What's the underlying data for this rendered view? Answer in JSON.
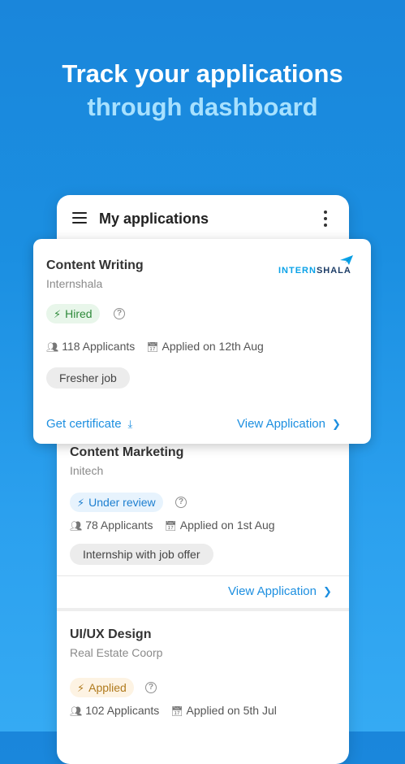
{
  "headline": {
    "line1": "Track your applications",
    "line2": "through dashboard"
  },
  "appbar": {
    "title": "My applications"
  },
  "highlighted_card": {
    "title": "Content Writing",
    "company": "Internshala",
    "logo": {
      "part1": "INTERN",
      "part2": "SHALA"
    },
    "status": {
      "label": "Hired",
      "color": "#e8f6ea",
      "text_color": "#2e8a3a"
    },
    "applicants": "118 Applicants",
    "applied_on": "Applied on 12th Aug",
    "tag": "Fresher job",
    "get_certificate": "Get certificate",
    "view_application": "View Application"
  },
  "cards": [
    {
      "title": "Content Marketing",
      "company": "Initech",
      "status": {
        "label": "Under review",
        "color": "#e7f3fd",
        "text_color": "#1d7fd0"
      },
      "applicants": "78 Applicants",
      "applied_on": "Applied on 1st Aug",
      "tag": "Internship with job offer",
      "view_application": "View Application"
    },
    {
      "title": "UI/UX Design",
      "company": "Real Estate Coorp",
      "status": {
        "label": "Applied",
        "color": "#fdf3e3",
        "text_color": "#b07a1c"
      },
      "applicants": "102 Applicants",
      "applied_on": "Applied on 5th Jul"
    }
  ],
  "icons": {
    "menu": "hamburger-menu-icon",
    "more": "vertical-dots-icon",
    "status": "lightning-bolt-icon",
    "help": "question-circle-icon",
    "applicants": "people-icon",
    "applied_on": "calendar-icon",
    "download": "download-icon",
    "chevron": "chevron-right-icon"
  }
}
